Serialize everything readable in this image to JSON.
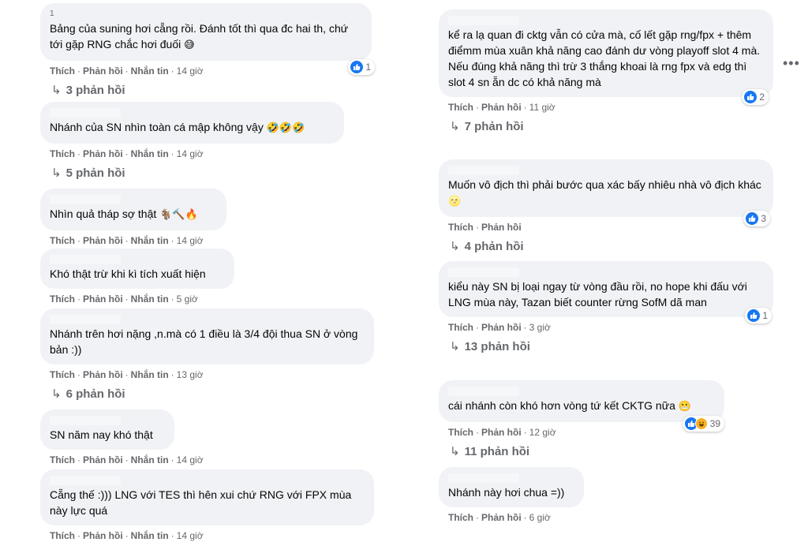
{
  "actions": {
    "like": "Thích",
    "reply": "Phản hồi",
    "message": "Nhắn tin"
  },
  "more_menu_icon": "more-horizontal-icon",
  "left_column": [
    {
      "author_hint": "1",
      "text": "Bảng của suning hơi cẵng rồi. Đánh tốt thì qua đc hai th, chứ tới gặp RNG chắc hơi đuối",
      "emoji": "😅",
      "time": "14 giờ",
      "has_message": true,
      "reaction_count": "1",
      "replies": "3 phản hồi"
    },
    {
      "author_hint": "",
      "text": "Nhánh của SN nhìn toàn cá mập không vậy",
      "emoji": "🤣🤣🤣",
      "time": "14 giờ",
      "has_message": true,
      "reaction_count": "",
      "replies": "5 phản hồi"
    },
    {
      "author_hint": "",
      "text": "Nhìn quả tháp sợ thật",
      "emoji": "🐐🔨🔥",
      "time": "14 giờ",
      "has_message": true,
      "reaction_count": "",
      "replies": ""
    },
    {
      "author_hint": "",
      "text": "Khó thật trừ khi kì tích xuất hiện",
      "emoji": "",
      "time": "5 giờ",
      "has_message": true,
      "reaction_count": "",
      "replies": ""
    },
    {
      "author_hint": "",
      "text": "Nhánh trên hơi nặng ,n.mà có 1 điều là 3/4 đội thua SN ở vòng bản :))",
      "emoji": "",
      "time": "13 giờ",
      "has_message": true,
      "reaction_count": "",
      "replies": "6 phản hồi"
    },
    {
      "author_hint": "",
      "text": "SN năm nay khó thật",
      "emoji": "",
      "time": "14 giờ",
      "has_message": true,
      "reaction_count": "",
      "replies": ""
    },
    {
      "author_hint": "",
      "text": "Cẵng thế :))) LNG với TES thì hên xui chứ RNG với FPX mùa này lực quá",
      "emoji": "",
      "time": "14 giờ",
      "has_message": true,
      "reaction_count": "",
      "replies": ""
    }
  ],
  "right_column": [
    {
      "author_hint": "",
      "text": "kể ra lạ quan đi cktg vẫn có cửa mà, cố lết gặp rng/fpx + thêm điểmm mùa xuân khả năng cao đánh dư vòng playoff slot 4 mà. Nếu đúng khả năng thì trừ 3 thắng khoai là rng fpx và edg thì slot 4 sn ẵn dc có khả năng mà",
      "emoji": "",
      "time": "11 giờ",
      "reaction_count": "2",
      "replies": "7 phản hồi"
    },
    {
      "author_hint": "",
      "text": "Muốn vô địch thì phải bước qua xác bấy nhiêu nhà vô địch khác",
      "emoji": "🌝",
      "time": "",
      "reaction_count": "3",
      "replies": "4 phản hồi"
    },
    {
      "author_hint": "",
      "text": "kiểu này SN bị loại ngay từ vòng đầu rồi, no hope khi đấu với LNG mùa này, Tazan biết counter rừng SofM dã man",
      "emoji": "",
      "time": "3 giờ",
      "reaction_count": "1",
      "replies": "13 phản hồi"
    },
    {
      "author_hint": "",
      "text": "cái nhánh còn khó hơn vòng tứ kết CKTG nữa",
      "emoji": "😬",
      "time": "12 giờ",
      "reaction_count": "39",
      "replies": "11 phản hồi"
    },
    {
      "author_hint": "",
      "text": "Nhánh này hơi chua =))",
      "emoji": "",
      "time": "6 giờ",
      "reaction_count": "",
      "replies": ""
    }
  ]
}
